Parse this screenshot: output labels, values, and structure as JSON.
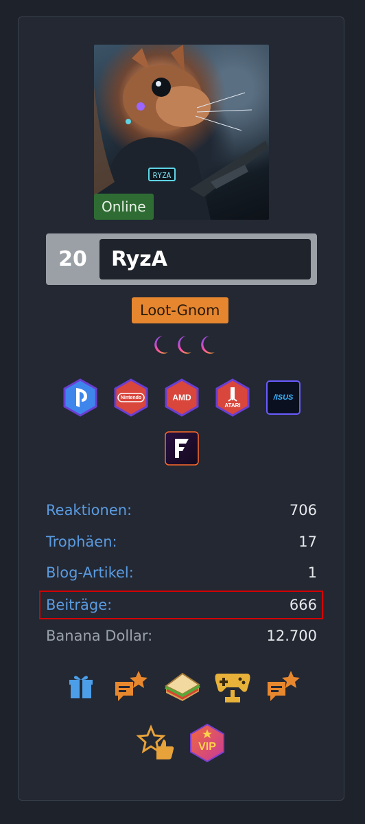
{
  "profile": {
    "status": "Online",
    "level": "20",
    "username": "RyzA",
    "rank": "Loot-Gnom",
    "avatar_label": "RYZA"
  },
  "badges": [
    {
      "icon": "playstation-icon",
      "text": ""
    },
    {
      "icon": "nintendo-icon",
      "text": "Nintendo"
    },
    {
      "icon": "amd-icon",
      "text": "AMD"
    },
    {
      "icon": "atari-icon",
      "text": "ATARI"
    },
    {
      "icon": "asus-icon",
      "text": "/ISUS"
    },
    {
      "icon": "fanatical-icon",
      "text": ""
    }
  ],
  "stats": [
    {
      "label": "Reaktionen:",
      "value": "706"
    },
    {
      "label": "Trophäen:",
      "value": "17"
    },
    {
      "label": "Blog-Artikel:",
      "value": "1"
    },
    {
      "label": "Beiträge:",
      "value": "666"
    },
    {
      "label": "Banana Dollar:",
      "value": "12.700"
    }
  ],
  "trophies": [
    {
      "icon": "gift-icon"
    },
    {
      "icon": "chat-star-icon"
    },
    {
      "icon": "sandwich-icon"
    },
    {
      "icon": "gamepad-trophy-icon"
    },
    {
      "icon": "chat-star-icon"
    },
    {
      "icon": "thumbs-up-star-icon"
    },
    {
      "icon": "vip-icon",
      "text": "VIP"
    }
  ],
  "colors": {
    "background": "#1e232b",
    "card": "#232833",
    "online": "#2f6c34",
    "rank": "#e6862f",
    "link": "#5b9be0",
    "highlight": "#d40000",
    "trophy_orange": "#e8882e"
  }
}
